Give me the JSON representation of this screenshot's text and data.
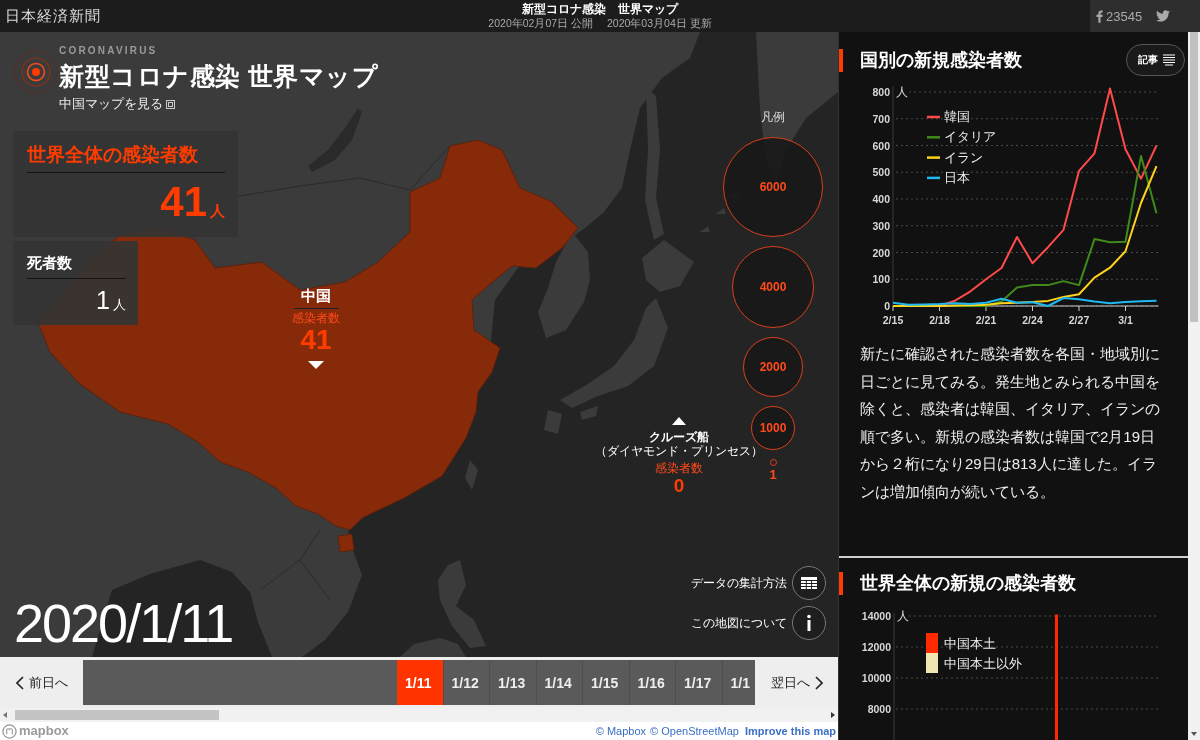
{
  "header": {
    "logo": "日本経済新聞",
    "title": "新型コロナ感染　世界マップ",
    "dates": [
      "2020年02月07日 公開",
      "2020年03月04日 更新"
    ],
    "share_count": "23545"
  },
  "map": {
    "kicker": "CORONAVIRUS",
    "title": "新型コロナ感染 世界マップ",
    "link": "中国マップを見る",
    "stats": [
      {
        "kind": "total",
        "label": "世界全体の感染者数",
        "value": "41",
        "unit": "人"
      },
      {
        "kind": "deaths",
        "label": "死者数",
        "value": "1",
        "unit": "人"
      }
    ],
    "markers": [
      {
        "kind": "country",
        "name": "中国",
        "caption": "感染者数",
        "value": "41"
      },
      {
        "kind": "ship",
        "name": "クルーズ船",
        "subtitle": "（ダイヤモンド・プリンセス）",
        "caption": "感染者数",
        "value": "0"
      }
    ],
    "legend": {
      "title": "凡例",
      "items": [
        {
          "kind": "bubble",
          "label": "6000"
        },
        {
          "kind": "bubble",
          "label": "4000"
        },
        {
          "kind": "bubble",
          "label": "2000"
        },
        {
          "kind": "bubble",
          "label": "1000"
        },
        {
          "kind": "dot",
          "label": "1"
        }
      ]
    },
    "date": "2020/1/11",
    "actions": [
      {
        "kind": "table",
        "label": "データの集計方法"
      },
      {
        "kind": "info",
        "label": "この地図について"
      }
    ]
  },
  "timeline": {
    "prev": "前日へ",
    "next": "翌日へ",
    "dates": [
      {
        "label": "1/11",
        "selected": true
      },
      {
        "label": "1/12",
        "selected": false
      },
      {
        "label": "1/13",
        "selected": false
      },
      {
        "label": "1/14",
        "selected": false
      },
      {
        "label": "1/15",
        "selected": false
      },
      {
        "label": "1/16",
        "selected": false
      },
      {
        "label": "1/17",
        "selected": false
      },
      {
        "label": "1/1",
        "selected": false
      }
    ]
  },
  "footer": {
    "logo": "mapbox",
    "credits": [
      "© Mapbox",
      "© OpenStreetMap"
    ],
    "improve": "Improve this map"
  },
  "panels": [
    {
      "title": "国別の新規感染者数",
      "button": "記事",
      "chart_data": {
        "type": "line",
        "categories": [
          "2/15",
          null,
          null,
          "2/18",
          null,
          null,
          "2/21",
          null,
          null,
          "2/24",
          null,
          null,
          "2/27",
          null,
          null,
          "3/1",
          null,
          null
        ],
        "ylim": [
          0,
          820
        ],
        "yticks": [
          0,
          100,
          200,
          300,
          400,
          500,
          600,
          700,
          800
        ],
        "ylabel": "人",
        "grid": true,
        "legend": "upper left",
        "series": [
          {
            "name": "韓国",
            "color": "#ff4a4a",
            "values": [
              null,
              null,
              1,
              1,
              20,
              55,
              100,
              142,
              258,
              160,
              220,
              285,
              505,
              571,
              813,
              586,
              476,
              600
            ]
          },
          {
            "name": "イタリア",
            "color": "#3f8a1a",
            "values": [
              null,
              null,
              null,
              null,
              0,
              0,
              0,
              17,
              69,
              78,
              78,
              93,
              78,
              250,
              238,
              240,
              561,
              347
            ]
          },
          {
            "name": "イラン",
            "color": "#ffd21c",
            "values": [
              0,
              0,
              0,
              0,
              2,
              3,
              5,
              10,
              12,
              15,
              19,
              34,
              44,
              106,
              143,
              205,
              385,
              523
            ]
          },
          {
            "name": "日本",
            "color": "#1fb8f0",
            "values": [
              12,
              5,
              6,
              7,
              10,
              8,
              12,
              27,
              12,
              14,
              0,
              30,
              25,
              17,
              10,
              15,
              18,
              20
            ]
          }
        ]
      },
      "text": "新たに確認された感染者数を各国・地域別に日ごとに見てみる。発生地とみられる中国を除くと、感染者は韓国、イタリア、イランの順で多い。新規の感染者数は韓国で2月19日から２桁になり29日は813人に達した。イランは増加傾向が続いている。"
    },
    {
      "title": "世界全体の新規の感染者数",
      "chart_data": {
        "type": "bar",
        "stacked": true,
        "ylim": [
          6000,
          14200
        ],
        "yticks": [
          8000,
          10000,
          12000,
          14000
        ],
        "ylabel": "人",
        "grid": true,
        "legend": "upper left",
        "series": [
          {
            "name": "中国本土",
            "color": "#ff2a00",
            "values": [
              null,
              null,
              null,
              null,
              null,
              null,
              null,
              null,
              null,
              null,
              null,
              null,
              null,
              null,
              null,
              null,
              null,
              null,
              null,
              null,
              null,
              null,
              null,
              null,
              14100,
              null,
              null,
              null,
              null,
              null,
              null,
              null,
              null,
              null,
              null,
              null,
              null,
              null,
              null,
              null
            ]
          },
          {
            "name": "中国本土以外",
            "color": "#efe6b0",
            "values": [
              null,
              null,
              null,
              null,
              null,
              null,
              null,
              null,
              null,
              null,
              null,
              null,
              null,
              null,
              null,
              null,
              null,
              null,
              null,
              null,
              null,
              null,
              null,
              null,
              null,
              null,
              null,
              null,
              null,
              null,
              null,
              null,
              null,
              null,
              null,
              null,
              null,
              null,
              null,
              null
            ]
          }
        ]
      }
    }
  ]
}
